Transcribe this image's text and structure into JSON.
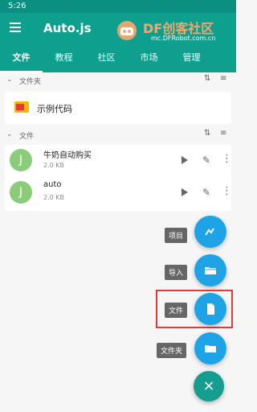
{
  "status": {
    "time": "5:26"
  },
  "toolbar": {
    "title": "Auto.js",
    "watermark": {
      "title": "DF创客社区",
      "url": "mc.DFRobot.com.cn"
    }
  },
  "tabs": [
    {
      "label": "文件",
      "active": true
    },
    {
      "label": "教程"
    },
    {
      "label": "社区"
    },
    {
      "label": "市场"
    },
    {
      "label": "管理"
    }
  ],
  "sections": {
    "folders": {
      "title": "文件夹",
      "items": [
        {
          "name": "示例代码"
        }
      ]
    },
    "files": {
      "title": "文件",
      "items": [
        {
          "avatar": "J",
          "name": "牛奶自动购买",
          "size": "2.0 KB"
        },
        {
          "avatar": "J",
          "name": "auto",
          "size": "2.0 KB"
        }
      ]
    }
  },
  "speed_dial": [
    {
      "label": "项目",
      "icon": "project-icon"
    },
    {
      "label": "导入",
      "icon": "folder-open-icon"
    },
    {
      "label": "文件",
      "icon": "file-icon"
    },
    {
      "label": "文件夹",
      "icon": "folder-icon"
    }
  ],
  "fab": {
    "icon": "close-icon",
    "symbol": "×"
  },
  "colors": {
    "primary": "#0e9f8f",
    "accent": "#1ea3e6",
    "highlight": "#e53935"
  }
}
